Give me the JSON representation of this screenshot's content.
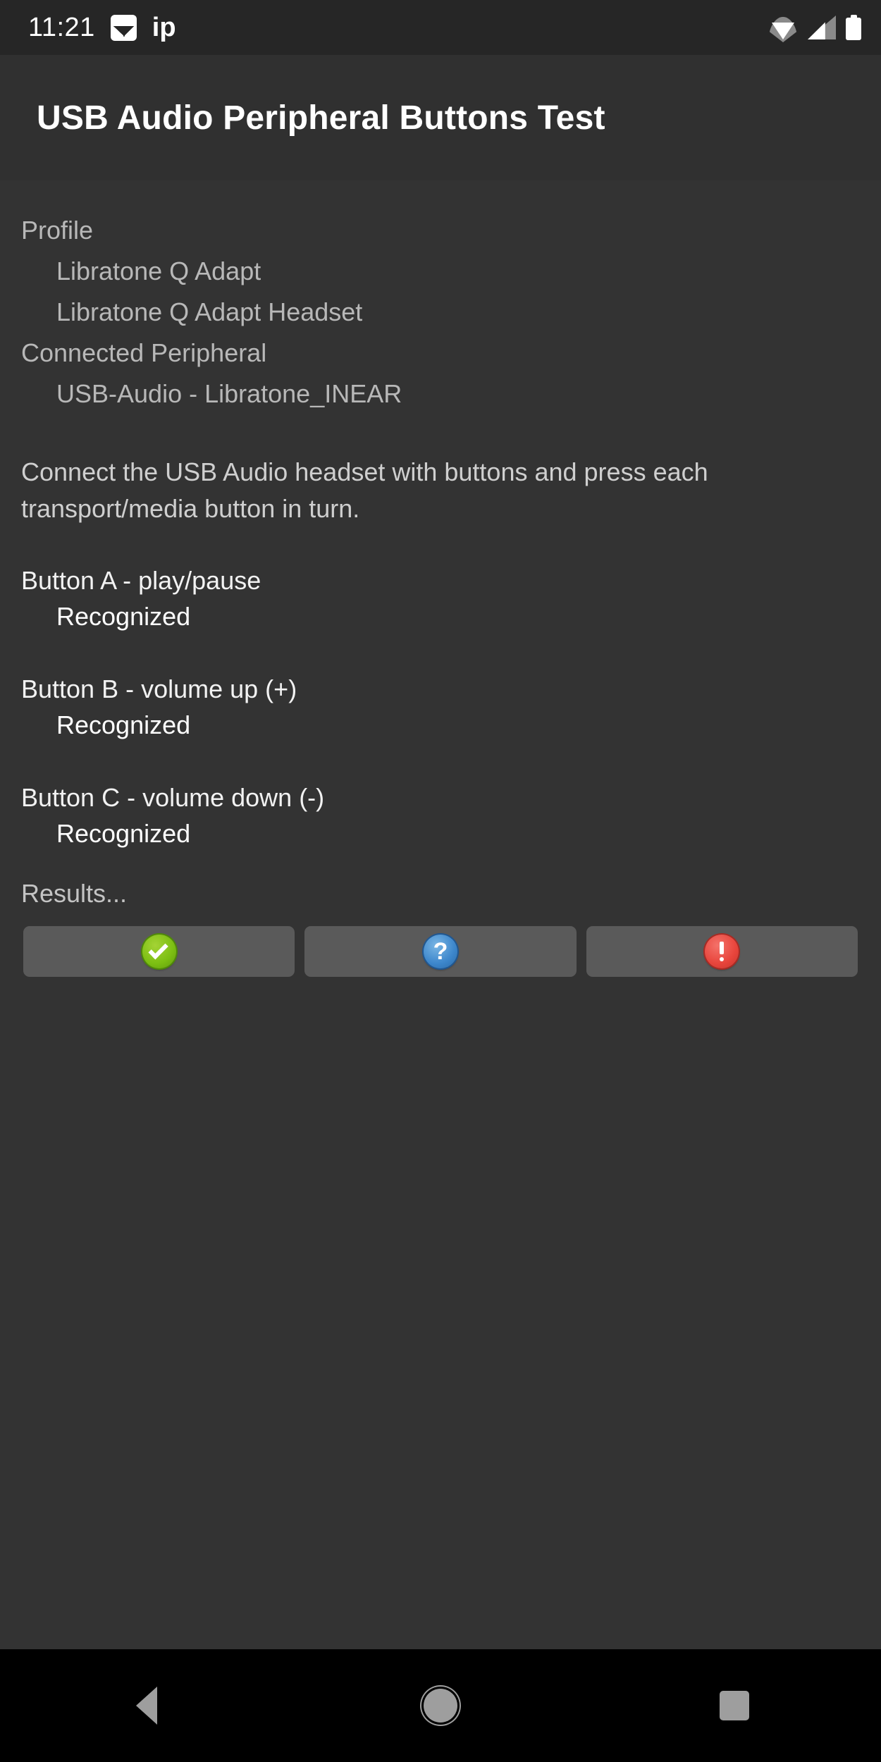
{
  "status_bar": {
    "time": "11:21",
    "notification_text": "ip",
    "icons": [
      "photo-icon",
      "wifi-icon",
      "cellular-signal-icon",
      "battery-icon"
    ]
  },
  "action_bar": {
    "title": "USB Audio Peripheral Buttons Test"
  },
  "profile": {
    "heading": "Profile",
    "entries": [
      "Libratone Q Adapt",
      "Libratone Q Adapt Headset"
    ]
  },
  "connected_peripheral": {
    "heading": "Connected Peripheral",
    "entries": [
      "USB-Audio - Libratone_INEAR"
    ]
  },
  "instructions": "Connect the USB Audio headset with buttons and press each transport/media button in turn.",
  "buttons": [
    {
      "title": "Button A - play/pause",
      "status": "Recognized"
    },
    {
      "title": "Button B - volume up (+)",
      "status": "Recognized"
    },
    {
      "title": "Button C - volume down (-)",
      "status": "Recognized"
    }
  ],
  "results": {
    "label": "Results...",
    "actions": [
      {
        "name": "pass",
        "icon": "check-circle-icon",
        "color": "#7cbf12"
      },
      {
        "name": "info",
        "icon": "question-circle-icon",
        "color": "#3d87cc"
      },
      {
        "name": "fail",
        "icon": "exclamation-circle-icon",
        "color": "#e8453c"
      }
    ]
  },
  "nav_bar": {
    "back": "back-icon",
    "home": "home-icon",
    "recents": "recents-icon"
  },
  "colors": {
    "window_background": "#333333",
    "action_bar": "#303030",
    "status_bar": "#262626",
    "nav_bar": "#000000",
    "button_background": "#5a5a5a"
  }
}
